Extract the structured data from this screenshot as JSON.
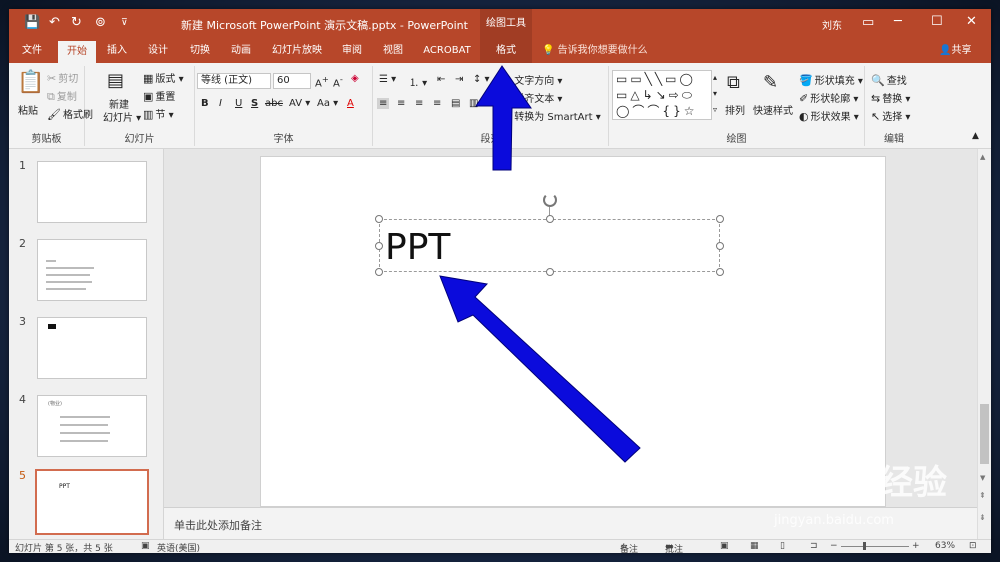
{
  "window": {
    "title": "新建 Microsoft PowerPoint 演示文稿.pptx  -  PowerPoint",
    "context_tab_group": "绘图工具",
    "user": "刘东",
    "quick_access": [
      "save-icon",
      "undo-icon",
      "redo-icon",
      "present-icon",
      "customize-icon"
    ]
  },
  "tabs": [
    {
      "label": "文件"
    },
    {
      "label": "开始"
    },
    {
      "label": "插入"
    },
    {
      "label": "设计"
    },
    {
      "label": "切换"
    },
    {
      "label": "动画"
    },
    {
      "label": "幻灯片放映"
    },
    {
      "label": "审阅"
    },
    {
      "label": "视图"
    },
    {
      "label": "ACROBAT"
    },
    {
      "label": "格式"
    }
  ],
  "tell_me": "告诉我你想要做什么",
  "share": "共享",
  "ribbon": {
    "clipboard": {
      "label": "剪贴板",
      "paste": "粘贴",
      "cut": "剪切",
      "copy": "复制",
      "format_painter": "格式刷"
    },
    "slides": {
      "label": "幻灯片",
      "new_slide_1": "新建",
      "new_slide_2": "幻灯片",
      "layout": "版式",
      "reset": "重置",
      "section": "节"
    },
    "font": {
      "label": "字体",
      "name": "等线 (正文)",
      "size": "60",
      "bold": "B",
      "italic": "I",
      "underline": "U",
      "strike": "S",
      "shadow": "abc",
      "spacing": "AV",
      "case": "Aa",
      "color": "A"
    },
    "paragraph": {
      "label": "段落",
      "text_direction": "文字方向",
      "align_text": "对齐文本",
      "smartart": "转换为 SmartArt"
    },
    "drawing": {
      "label": "绘图",
      "arrange": "排列",
      "quick_styles": "快速样式",
      "fill": "形状填充",
      "outline": "形状轮廓",
      "effects": "形状效果"
    },
    "editing": {
      "label": "编辑",
      "find": "查找",
      "replace": "替换",
      "select": "选择"
    }
  },
  "thumbnails": [
    {
      "num": "1",
      "text": ""
    },
    {
      "num": "2",
      "text": ""
    },
    {
      "num": "3",
      "text": ""
    },
    {
      "num": "4",
      "text": "(物业)"
    },
    {
      "num": "5",
      "text": "PPT"
    }
  ],
  "slide": {
    "text": "PPT"
  },
  "notes_placeholder": "单击此处添加备注",
  "status": {
    "slide_info": "幻灯片 第 5 张，共 5 张",
    "language": "英语(美国)",
    "notes": "备注",
    "comments": "批注",
    "zoom": "63%"
  },
  "watermark": {
    "brand": "Baidu经验",
    "url": "jingyan.baidu.com"
  },
  "annotations": {
    "arrow_color": "#0b0bdc"
  }
}
